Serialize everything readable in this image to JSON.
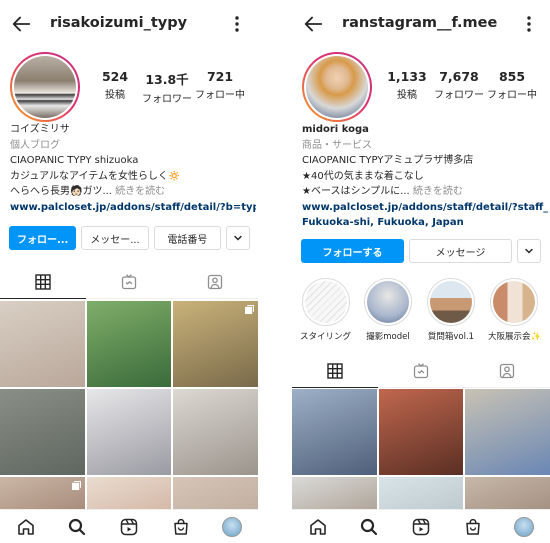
{
  "left": {
    "username": "risakoizumi_typy",
    "stats": [
      {
        "value": "524",
        "label": "投稿"
      },
      {
        "value": "13.8千",
        "label": "フォロワー"
      },
      {
        "value": "721",
        "label": "フォロー中"
      }
    ],
    "bio": {
      "name": "コイズミリサ",
      "category": "個人ブログ",
      "line1": "CIAOPANIC TYPY  shizuoka",
      "line2": "カジュアルなアイテムを女性らしく🔅",
      "line3": "へらへら長男🧑🏻ガツ...",
      "more": " 続きを読む",
      "link": "www.palcloset.jp/addons/staff/detail/?b=typy&sta..."
    },
    "buttons": {
      "follow": "フォロー...",
      "message": "メッセー...",
      "phone": "電話番号"
    },
    "grid_colors": [
      [
        "#d9cfc4",
        "#b9a79a"
      ],
      [
        "#7fae6a",
        "#3b6b3a"
      ],
      [
        "#c9b27a",
        "#7a6a4a"
      ],
      [
        "#8a8f86",
        "#5f6660"
      ],
      [
        "#e7e7e9",
        "#9a9aa2"
      ],
      [
        "#dcd8d2",
        "#9a948c"
      ],
      [
        "#cbb6a5",
        "#8a6a5a"
      ],
      [
        "#e9dcd0",
        "#c49a86"
      ],
      [
        "#d6c6b8",
        "#b09a8a"
      ]
    ]
  },
  "right": {
    "username": "ranstagram__f.mee",
    "stats": [
      {
        "value": "1,133",
        "label": "投稿"
      },
      {
        "value": "7,678",
        "label": "フォロワー"
      },
      {
        "value": "855",
        "label": "フォロー中"
      }
    ],
    "bio": {
      "name": "midori koga",
      "category": "商品・サービス",
      "line1": "CIAOPANIC TYPYアミュプラザ博多店",
      "line2": "★40代の気ままな着こなし",
      "line3": "★ベースはシンプルに...",
      "more": " 続きを読む",
      "link": "www.palcloset.jp/addons/staff/detail/?staff_id=25...",
      "location": "Fukuoka-shi, Fukuoka, Japan"
    },
    "buttons": {
      "follow": "フォローする",
      "message": "メッセージ"
    },
    "highlights": [
      {
        "label": "スタイリング...",
        "color": "#f4f4f4"
      },
      {
        "label": "撮影model",
        "color": "#c7d3e6"
      },
      {
        "label": "質問箱vol.1",
        "color": "#e0d0c0"
      },
      {
        "label": "大阪展示会✨",
        "color": "#d9b8a6"
      }
    ],
    "grid_colors": [
      [
        "#9db0c6",
        "#4f5f7a"
      ],
      [
        "#c0674e",
        "#5a2f24"
      ],
      [
        "#c8c2b4",
        "#6a87b4"
      ],
      [
        "#dadad8",
        "#8c7a66"
      ],
      [
        "#d9e4e8",
        "#a6b4b8"
      ],
      [
        "#c6b8aa",
        "#8a7060"
      ]
    ]
  }
}
